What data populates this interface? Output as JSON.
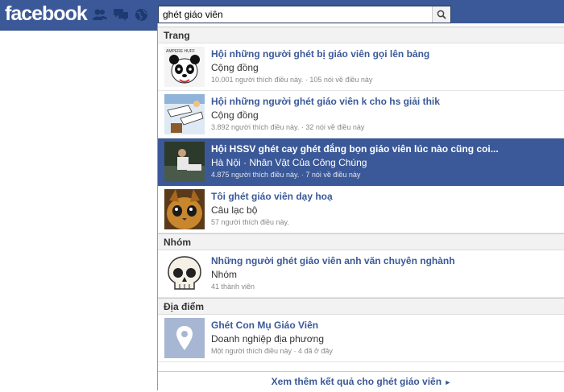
{
  "header": {
    "logo": "facebook",
    "search_value": "ghét giáo viên"
  },
  "sections": {
    "pages_title": "Trang",
    "groups_title": "Nhóm",
    "places_title": "Địa điểm"
  },
  "pages": [
    {
      "title": "Hội những người ghét bị giáo viên gọi lên bảng",
      "subtitle": "Cộng đồng",
      "meta": "10.001 người thích điều này. · 105 nói về điều này",
      "thumb_text": "AMPERE HUFF"
    },
    {
      "title": "Hội những người ghét giáo viên k cho hs giải thik",
      "subtitle": "Cộng đồng",
      "meta": "3.892 người thích điều này. · 32 nói về điều này"
    },
    {
      "title": "Hội HSSV ghét cay ghét đắng bọn giáo viên lúc nào cũng coi...",
      "subtitle": "Hà Nội · Nhân Vật Của Công Chúng",
      "meta": "4.875 người thích điều này. · 7 nói về điều này",
      "selected": true
    },
    {
      "title": "Tôi ghét giáo viên dạy hoạ",
      "subtitle": "Câu lạc bộ",
      "meta": "57 người thích điều này."
    }
  ],
  "groups": [
    {
      "title": "Những người ghét giáo viên anh văn chuyên nghành",
      "subtitle": "Nhóm",
      "meta": "41 thành viên"
    }
  ],
  "places": [
    {
      "title": "Ghét Con Mụ Giáo Viên",
      "subtitle": "Doanh nghiệp địa phương",
      "meta": "Một người thích điều này · 4 đã ở đây"
    }
  ],
  "see_more": "Xem thêm kết quả cho ghét giáo viên",
  "icons": [
    "friend-requests-icon",
    "messages-icon",
    "notifications-icon",
    "search-icon",
    "skull-icon",
    "map-pin-icon"
  ],
  "colors": {
    "brand": "#3b5998",
    "selected_row": "#3b5998"
  }
}
